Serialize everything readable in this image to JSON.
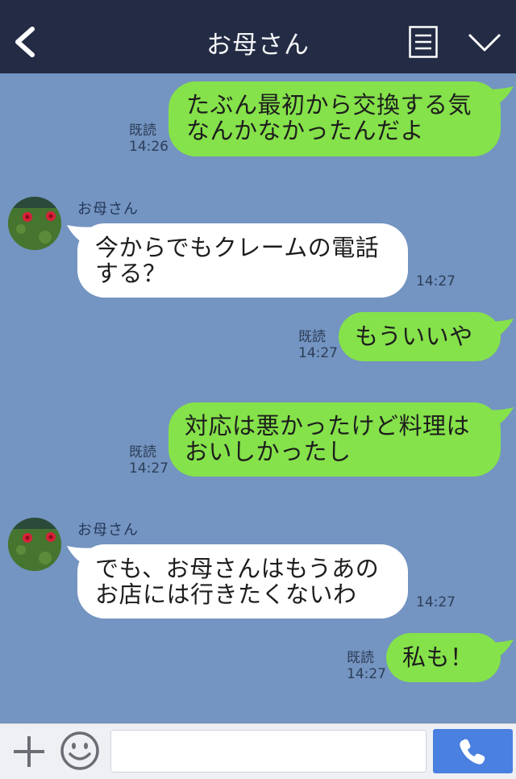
{
  "header": {
    "title": "お母さん"
  },
  "messages": [
    {
      "from": "me",
      "text": "たぶん最初から交換する気\nなんかなかったんだよ",
      "read": "既読",
      "time": "14:26"
    },
    {
      "from": "them",
      "sender": "お母さん",
      "text": "今からでもクレームの電話\nする？",
      "time": "14:27"
    },
    {
      "from": "me",
      "text": "もういいや",
      "read": "既読",
      "time": "14:27"
    },
    {
      "from": "me",
      "text": "対応は悪かったけど料理は\nおいしかったし",
      "read": "既読",
      "time": "14:27"
    },
    {
      "from": "them",
      "sender": "お母さん",
      "text": "でも、お母さんはもうあの\nお店には行きたくないわ",
      "time": "14:27"
    },
    {
      "from": "me",
      "text": "私も！",
      "read": "既読",
      "time": "14:27"
    }
  ],
  "footer": {
    "input_value": ""
  },
  "colors": {
    "background": "#7494c1",
    "header": "#232c44",
    "my_bubble": "#85e24a",
    "their_bubble": "#ffffff",
    "send_button": "#4a80df"
  },
  "icons": [
    "back-icon",
    "menu-icon",
    "chevron-down-icon",
    "plus-icon",
    "smile-icon",
    "phone-icon"
  ]
}
